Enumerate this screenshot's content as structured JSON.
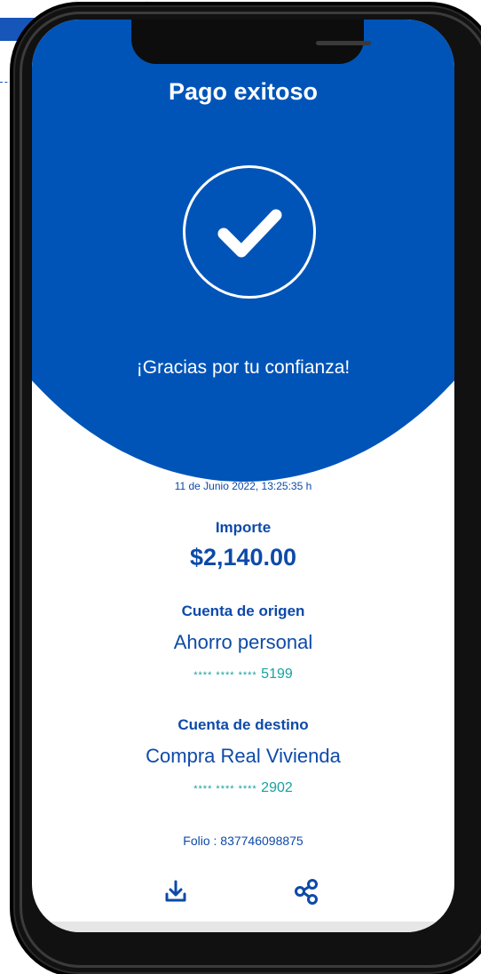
{
  "header": {
    "title": "Pago exitoso",
    "message": "¡Gracias por tu confianza!"
  },
  "receipt": {
    "date": "11 de Junio 2022, 13:25:35 h",
    "amount_label": "Importe",
    "amount": "$2,140.00",
    "origin": {
      "label": "Cuenta de origen",
      "name": "Ahorro personal",
      "mask": "**** **** ****",
      "last4": "5199"
    },
    "destination": {
      "label": "Cuenta de destino",
      "name": "Compra Real Vivienda",
      "mask": "**** **** ****",
      "last4": "2902"
    },
    "folio": "Folio : 837746098875"
  },
  "actions": {
    "download_icon": "download-icon",
    "share_icon": "share-icon"
  },
  "colors": {
    "primary": "#0054b8",
    "text_blue": "#0d4aa8",
    "teal": "#16a3a0"
  }
}
